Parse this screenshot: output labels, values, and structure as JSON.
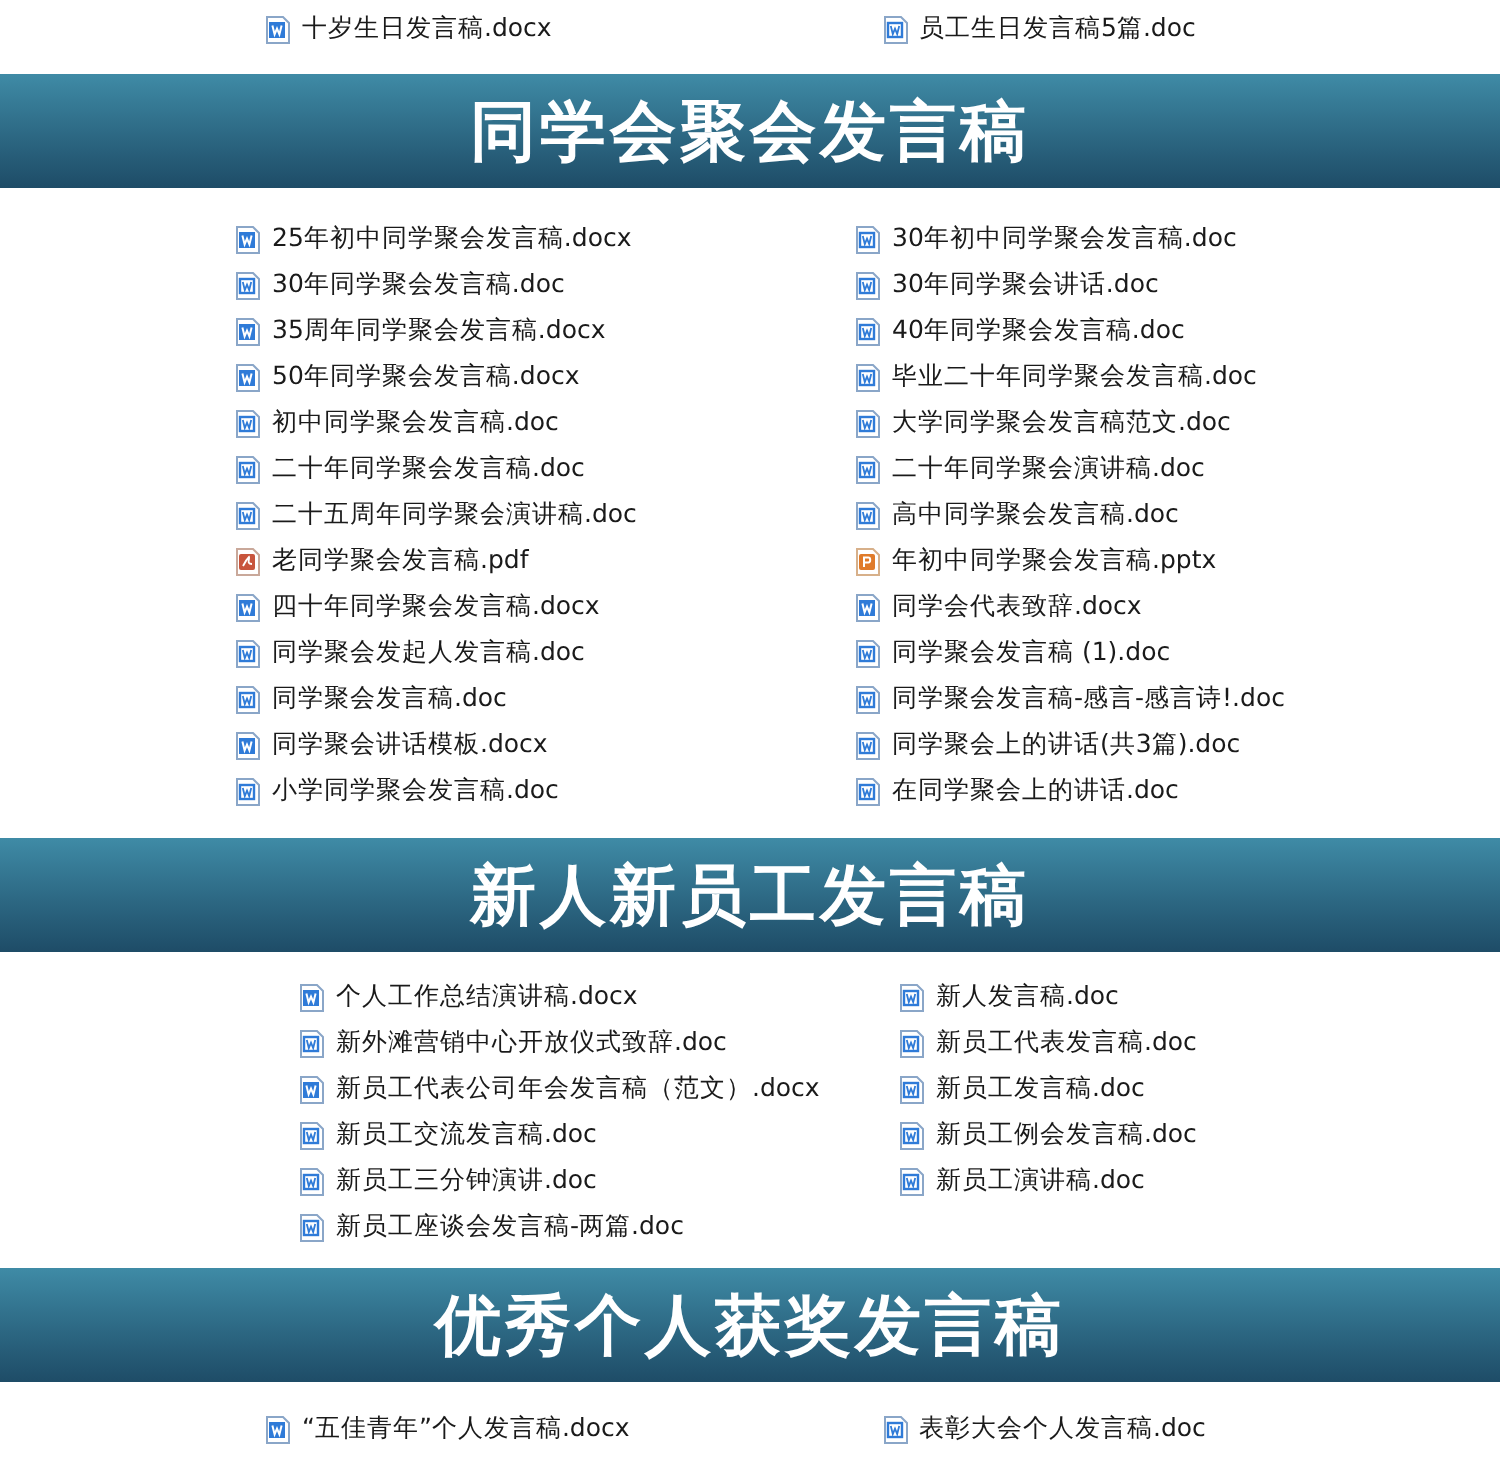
{
  "sections": [
    {
      "left": [
        {
          "name": "十岁生日发言稿.docx",
          "kind": "docx"
        }
      ],
      "right": [
        {
          "name": "员工生日发言稿5篇.doc",
          "kind": "doc"
        }
      ]
    },
    {
      "title": "同学会聚会发言稿",
      "left": [
        {
          "name": "25年初中同学聚会发言稿.docx",
          "kind": "docx"
        },
        {
          "name": "30年同学聚会发言稿.doc",
          "kind": "doc"
        },
        {
          "name": "35周年同学聚会发言稿.docx",
          "kind": "docx"
        },
        {
          "name": "50年同学聚会发言稿.docx",
          "kind": "docx"
        },
        {
          "name": "初中同学聚会发言稿.doc",
          "kind": "doc"
        },
        {
          "name": "二十年同学聚会发言稿.doc",
          "kind": "doc"
        },
        {
          "name": "二十五周年同学聚会演讲稿.doc",
          "kind": "doc"
        },
        {
          "name": "老同学聚会发言稿.pdf",
          "kind": "pdf"
        },
        {
          "name": "四十年同学聚会发言稿.docx",
          "kind": "docx"
        },
        {
          "name": "同学聚会发起人发言稿.doc",
          "kind": "doc"
        },
        {
          "name": "同学聚会发言稿.doc",
          "kind": "doc"
        },
        {
          "name": "同学聚会讲话模板.docx",
          "kind": "docx"
        },
        {
          "name": "小学同学聚会发言稿.doc",
          "kind": "doc"
        }
      ],
      "right": [
        {
          "name": "30年初中同学聚会发言稿.doc",
          "kind": "doc"
        },
        {
          "name": "30年同学聚会讲话.doc",
          "kind": "doc"
        },
        {
          "name": "40年同学聚会发言稿.doc",
          "kind": "doc"
        },
        {
          "name": "毕业二十年同学聚会发言稿.doc",
          "kind": "doc"
        },
        {
          "name": "大学同学聚会发言稿范文.doc",
          "kind": "doc"
        },
        {
          "name": "二十年同学聚会演讲稿.doc",
          "kind": "doc"
        },
        {
          "name": "高中同学聚会发言稿.doc",
          "kind": "doc"
        },
        {
          "name": "年初中同学聚会发言稿.pptx",
          "kind": "pptx"
        },
        {
          "name": "同学会代表致辞.docx",
          "kind": "docx"
        },
        {
          "name": "同学聚会发言稿 (1).doc",
          "kind": "doc"
        },
        {
          "name": "同学聚会发言稿-感言-感言诗!.doc",
          "kind": "doc"
        },
        {
          "name": "同学聚会上的讲话(共3篇).doc",
          "kind": "doc"
        },
        {
          "name": "在同学聚会上的讲话.doc",
          "kind": "doc"
        }
      ]
    },
    {
      "title": "新人新员工发言稿",
      "left": [
        {
          "name": "个人工作总结演讲稿.docx",
          "kind": "docx"
        },
        {
          "name": "新外滩营销中心开放仪式致辞.doc",
          "kind": "doc"
        },
        {
          "name": "新员工代表公司年会发言稿（范文）.docx",
          "kind": "docx"
        },
        {
          "name": "新员工交流发言稿.doc",
          "kind": "doc"
        },
        {
          "name": "新员工三分钟演讲.doc",
          "kind": "doc"
        },
        {
          "name": "新员工座谈会发言稿-两篇.doc",
          "kind": "doc"
        }
      ],
      "right": [
        {
          "name": "新人发言稿.doc",
          "kind": "doc"
        },
        {
          "name": "新员工代表发言稿.doc",
          "kind": "doc"
        },
        {
          "name": "新员工发言稿.doc",
          "kind": "doc"
        },
        {
          "name": "新员工例会发言稿.doc",
          "kind": "doc"
        },
        {
          "name": "新员工演讲稿.doc",
          "kind": "doc"
        }
      ]
    },
    {
      "title": "优秀个人获奖发言稿",
      "left": [
        {
          "name": "“五佳青年”个人发言稿.docx",
          "kind": "docx"
        }
      ],
      "right": [
        {
          "name": "表彰大会个人发言稿.doc",
          "kind": "doc"
        }
      ]
    }
  ]
}
